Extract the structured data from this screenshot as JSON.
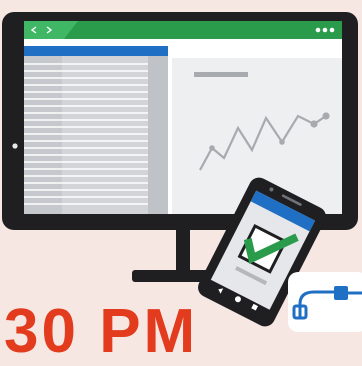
{
  "illustration": {
    "subject": "monitor-and-phone-workflow",
    "background_color": "#f7e7e3",
    "accent_green": "#2a9b4a",
    "accent_blue": "#1f6fc4",
    "accent_red": "#e23b1e",
    "icons": {
      "nav_back": "chevron-left-icon",
      "nav_forward": "chevron-right-icon",
      "window_controls": "window-dots-icon",
      "checkmark": "checkmark-icon",
      "flow": "flow-connector-icon"
    }
  },
  "banner_text": "30 PM"
}
